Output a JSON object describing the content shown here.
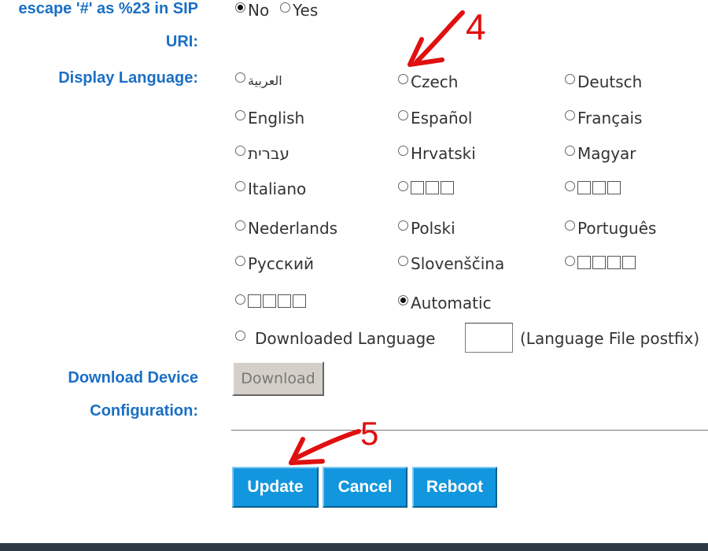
{
  "sip_escape": {
    "label_line1": "escape '#' as %23 in SIP",
    "label_line2": "URI:",
    "options": [
      {
        "label": "No",
        "checked": true
      },
      {
        "label": "Yes",
        "checked": false
      }
    ]
  },
  "display_language": {
    "label": "Display Language:",
    "options": [
      {
        "label": "العربية",
        "checked": false
      },
      {
        "label": "Czech",
        "checked": false
      },
      {
        "label": "Deutsch",
        "checked": false
      },
      {
        "label": "English",
        "checked": false
      },
      {
        "label": "Español",
        "checked": false
      },
      {
        "label": "Français",
        "checked": false
      },
      {
        "label": "עברית",
        "checked": false
      },
      {
        "label": "Hrvatski",
        "checked": false
      },
      {
        "label": "Magyar",
        "checked": false
      },
      {
        "label": "Italiano",
        "checked": false
      },
      {
        "label": "",
        "checked": false
      },
      {
        "label": "",
        "checked": false
      },
      {
        "label": "Nederlands",
        "checked": false
      },
      {
        "label": "Polski",
        "checked": false
      },
      {
        "label": "Português",
        "checked": false
      },
      {
        "label": "Русский",
        "checked": false
      },
      {
        "label": "Slovenščina",
        "checked": false
      },
      {
        "label": "",
        "checked": false
      },
      {
        "label": "",
        "checked": false
      },
      {
        "label": "Automatic",
        "checked": true
      }
    ],
    "downloaded_label": "Downloaded Language",
    "postfix_value": "",
    "postfix_note": "(Language File postfix)"
  },
  "download_config": {
    "label_line1": "Download Device",
    "label_line2": "Configuration:",
    "button": "Download"
  },
  "actions": {
    "update": "Update",
    "cancel": "Cancel",
    "reboot": "Reboot"
  },
  "annotations": {
    "step4": "4",
    "step5": "5",
    "color": "#e01010"
  },
  "colors": {
    "label_blue": "#1a6fc4",
    "button_blue": "#1296dd"
  }
}
